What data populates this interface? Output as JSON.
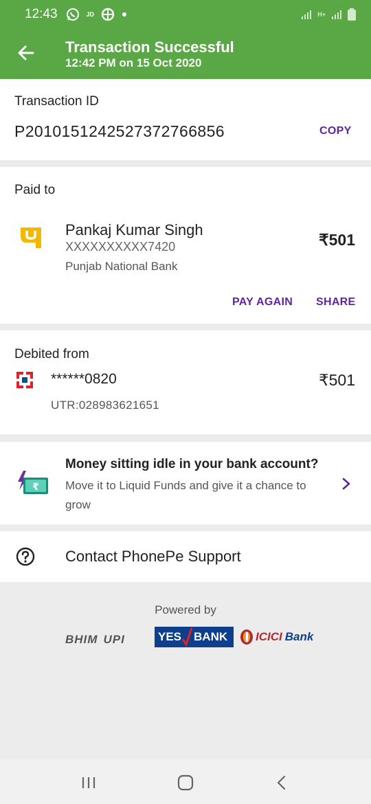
{
  "status": {
    "time": "12:43",
    "jd_label": "JD",
    "net_label": "H+"
  },
  "header": {
    "title": "Transaction Successful",
    "subtitle": "12:42 PM on 15 Oct 2020"
  },
  "transaction": {
    "label": "Transaction ID",
    "id": "P2010151242527372766856",
    "copy_label": "COPY"
  },
  "paid_to": {
    "label": "Paid to",
    "name": "Pankaj Kumar Singh",
    "account": "XXXXXXXXXX7420",
    "bank": "Punjab National Bank",
    "amount": "₹501",
    "pay_again_label": "PAY AGAIN",
    "share_label": "SHARE"
  },
  "debited": {
    "label": "Debited from",
    "account": "******0820",
    "amount": "₹501",
    "utr": "UTR:028983621651"
  },
  "promo": {
    "title": "Money sitting idle in your bank account?",
    "body": "Move it to Liquid Funds and give it a chance to grow",
    "icon_symbol": "₹"
  },
  "support": {
    "label": "Contact PhonePe Support"
  },
  "footer": {
    "powered_by": "Powered by",
    "logos": {
      "bhim": "BHIM",
      "upi": "UPI",
      "yes": "YES",
      "bank": "BANK",
      "icici": "ICICI",
      "icici_bank": "Bank"
    }
  },
  "colors": {
    "header_green": "#5aa845",
    "accent_purple": "#5f259f",
    "pnb_yellow": "#f5b800",
    "hdfc_red": "#e12129",
    "yes_blue": "#0d3f8c",
    "icici_red": "#b02a30"
  }
}
